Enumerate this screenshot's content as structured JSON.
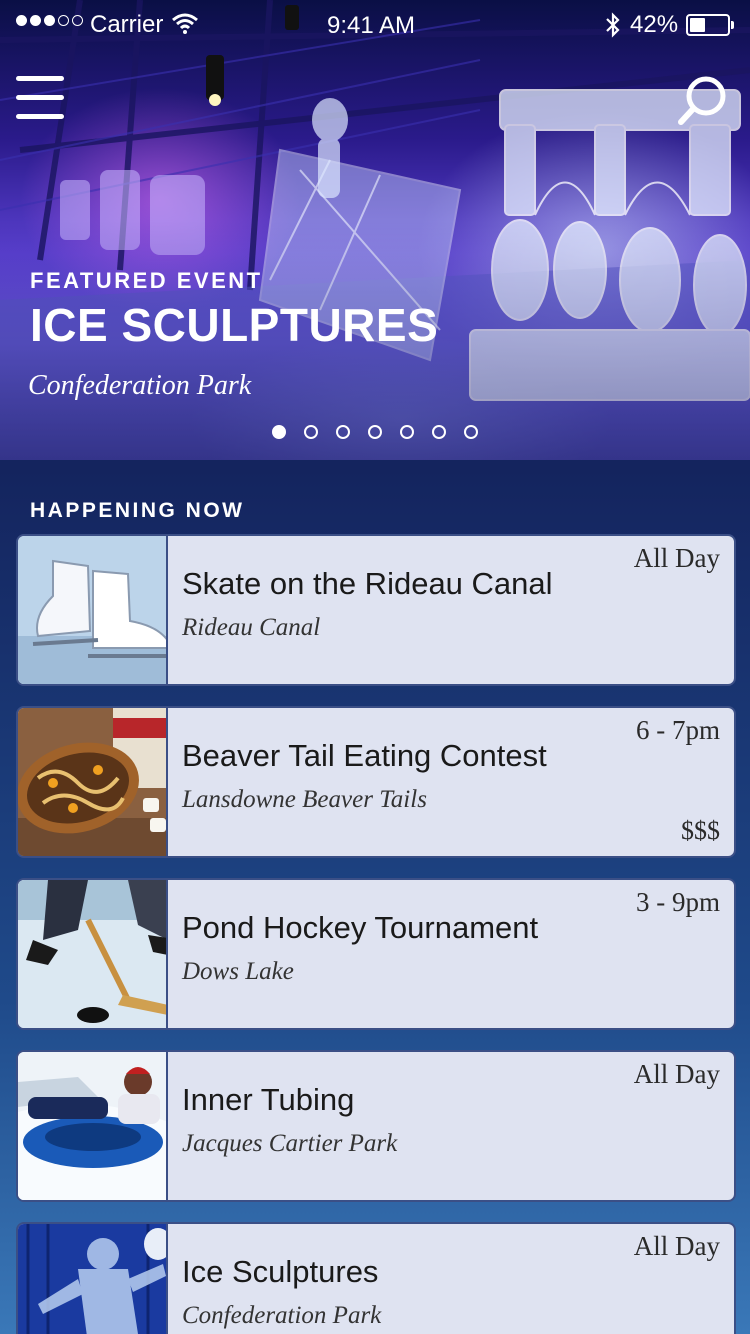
{
  "status_bar": {
    "carrier": "Carrier",
    "time": "9:41 AM",
    "battery_percent": "42%",
    "battery_level": 0.42,
    "signal_bars_filled": 3,
    "signal_bars_total": 5
  },
  "header": {
    "menu_icon": "hamburger-menu-icon",
    "search_icon": "search-icon"
  },
  "featured": {
    "label": "FEATURED EVENT",
    "title": "ICE SCULPTURES",
    "location": "Confederation Park",
    "carousel_count": 7,
    "carousel_active_index": 0
  },
  "happening_now": {
    "heading": "HAPPENING NOW",
    "events": [
      {
        "title": "Skate on the Rideau Canal",
        "venue": "Rideau Canal",
        "time": "All Day",
        "price": "",
        "image": "ice-skates"
      },
      {
        "title": "Beaver Tail Eating Contest",
        "venue": "Lansdowne Beaver Tails",
        "time": "6 - 7pm",
        "price": "$$$",
        "image": "beaver-tail-pastry"
      },
      {
        "title": "Pond Hockey Tournament",
        "venue": "Dows Lake",
        "time": "3 - 9pm",
        "price": "",
        "image": "hockey-player"
      },
      {
        "title": "Inner Tubing",
        "venue": "Jacques Cartier Park",
        "time": "All Day",
        "price": "",
        "image": "snow-tubing"
      },
      {
        "title": "Ice Sculptures",
        "venue": "Confederation Park",
        "time": "All Day",
        "price": "",
        "image": "ice-sculpture-skater"
      }
    ]
  },
  "colors": {
    "background_top": "#0c1450",
    "background_bottom": "#3a78b8",
    "card_background": "#dfe3f1",
    "card_border": "#3b4f86"
  }
}
